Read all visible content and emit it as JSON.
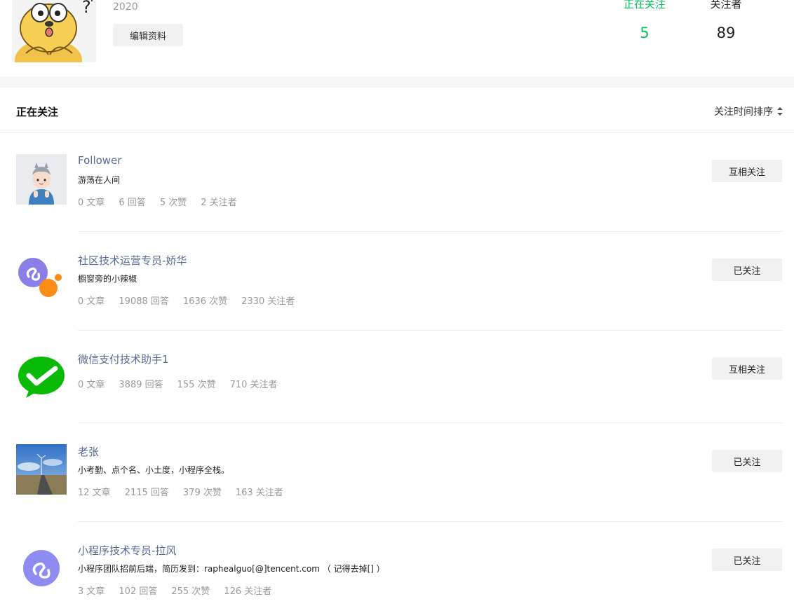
{
  "profile": {
    "year": "2020",
    "edit_label": "编辑资料"
  },
  "stats": {
    "following_label": "正在关注",
    "following_count": "5",
    "followers_label": "关注者",
    "followers_count": "89"
  },
  "section": {
    "title": "正在关注",
    "sort_label": "关注时间排序"
  },
  "colors": {
    "accent_green": "#07c160",
    "link_blue": "#576b95"
  },
  "items": [
    {
      "name": "Follower",
      "bio": "游荡在人间",
      "articles": "0 文章",
      "answers": "6 回答",
      "likes": "5 次赞",
      "followers": "2 关注者",
      "button": "互相关注"
    },
    {
      "name": "社区技术运营专员-娇华",
      "bio": "橱窗旁的小辣椒",
      "articles": "0 文章",
      "answers": "19088 回答",
      "likes": "1636 次赞",
      "followers": "2330 关注者",
      "button": "已关注"
    },
    {
      "name": "微信支付技术助手1",
      "bio": "",
      "articles": "0 文章",
      "answers": "3889 回答",
      "likes": "155 次赞",
      "followers": "710 关注者",
      "button": "互相关注"
    },
    {
      "name": "老张",
      "bio": "小考勤、点个名、小土度，小程序全栈。",
      "articles": "12 文章",
      "answers": "2115 回答",
      "likes": "379 次赞",
      "followers": "163 关注者",
      "button": "已关注"
    },
    {
      "name": "小程序技术专员-拉风",
      "bio": "小程序团队招前后端，简历发到：raphealguo[@]tencent.com （ 记得去掉[] ）",
      "articles": "3 文章",
      "answers": "102 回答",
      "likes": "255 次赞",
      "followers": "126 关注者",
      "button": "已关注"
    }
  ]
}
